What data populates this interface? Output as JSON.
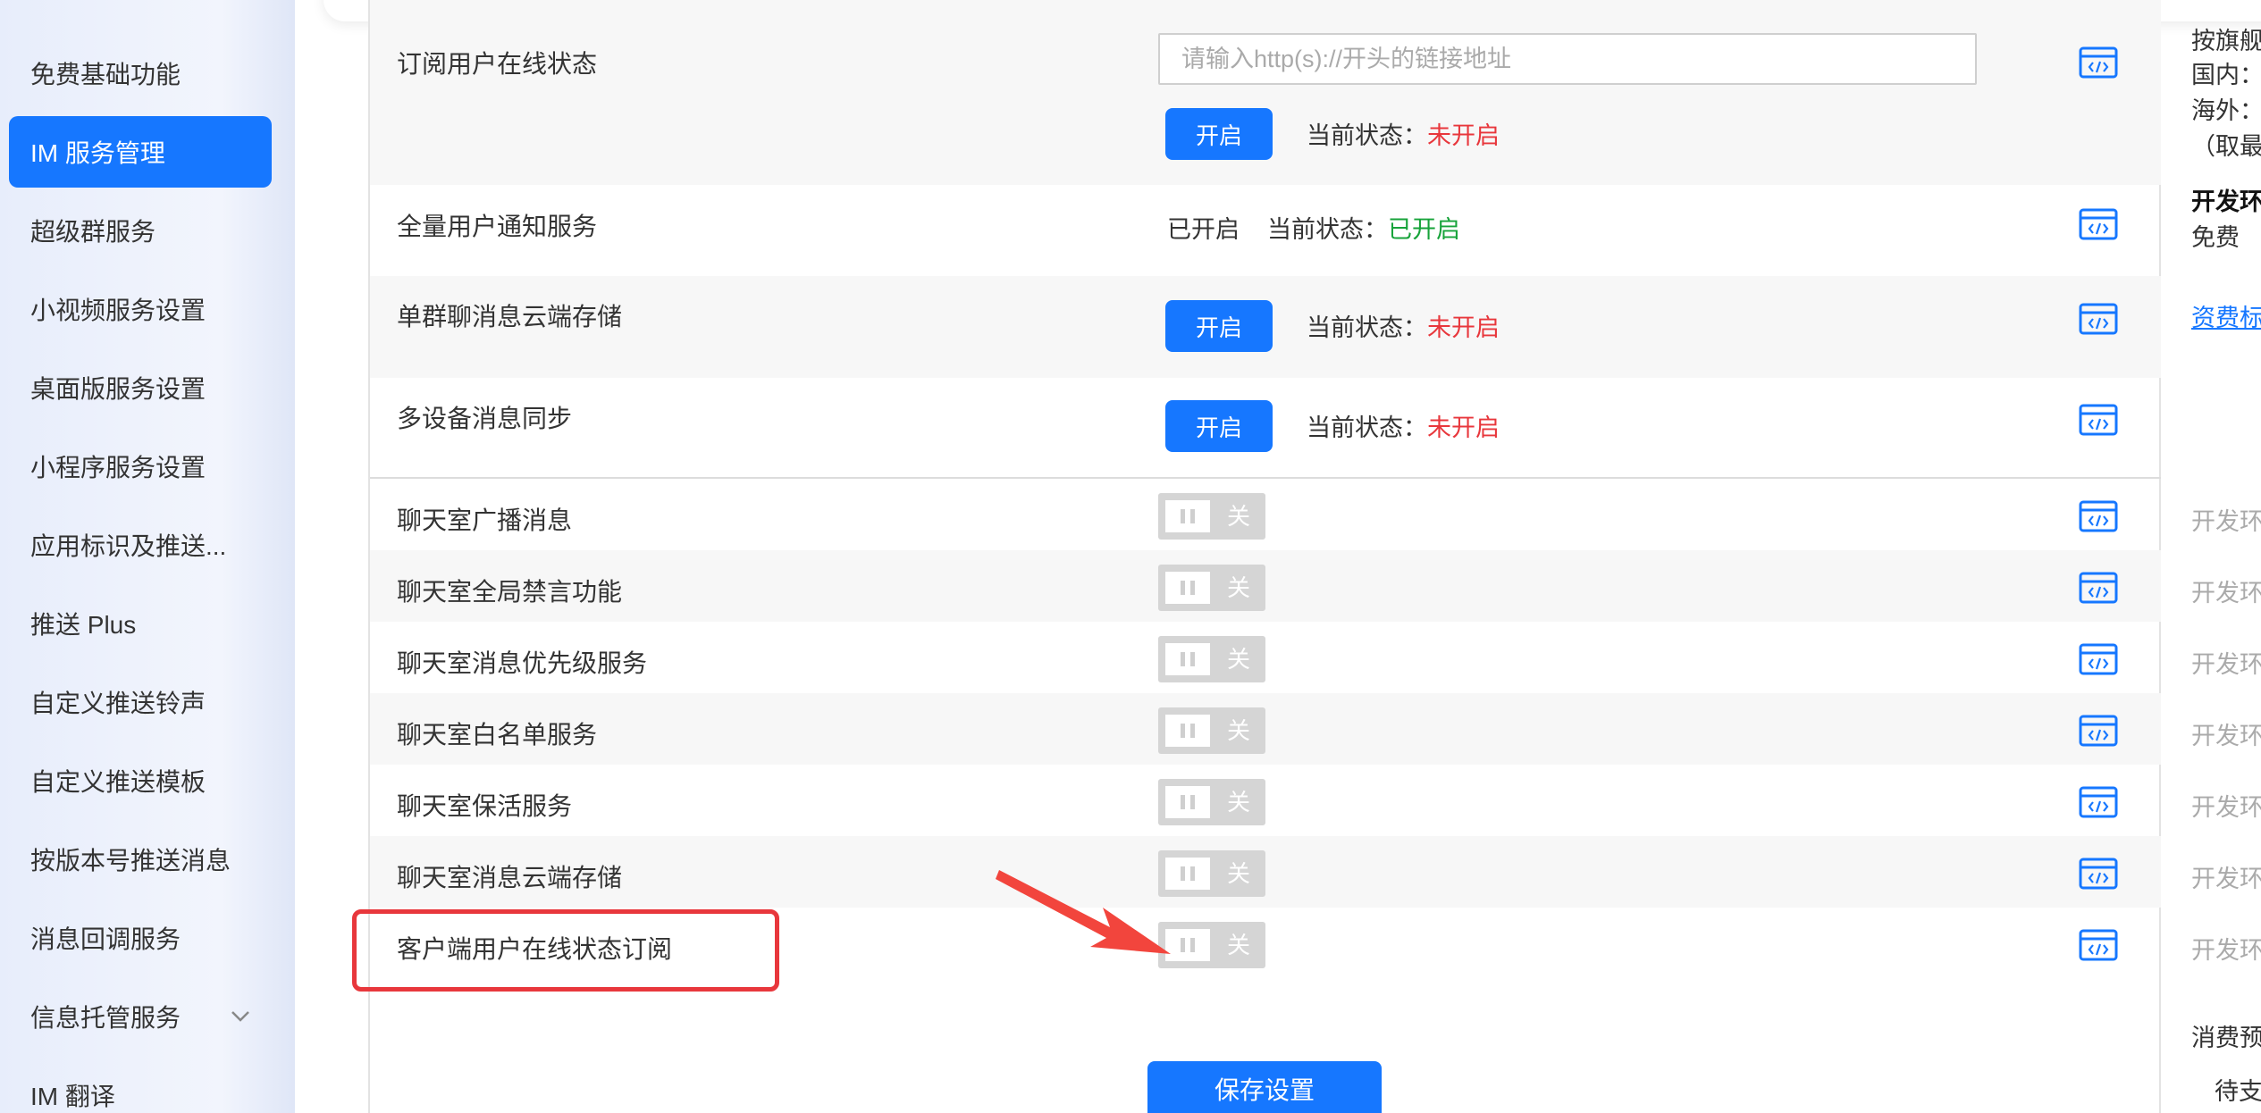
{
  "sidebar": {
    "items": [
      {
        "label": "免费基础功能"
      },
      {
        "label": "IM 服务管理",
        "active": true
      },
      {
        "label": "超级群服务"
      },
      {
        "label": "小视频服务设置"
      },
      {
        "label": "桌面版服务设置"
      },
      {
        "label": "小程序服务设置"
      },
      {
        "label": "应用标识及推送..."
      },
      {
        "label": "推送 Plus"
      },
      {
        "label": "自定义推送铃声"
      },
      {
        "label": "自定义推送模板"
      },
      {
        "label": "按版本号推送消息"
      },
      {
        "label": "消息回调服务"
      },
      {
        "label": "信息托管服务",
        "expandable": true,
        "icon": "chevron-down-icon"
      },
      {
        "label": "IM 翻译"
      }
    ]
  },
  "services": {
    "subscription": {
      "label": "订阅用户在线状态",
      "input_placeholder": "请输入http(s)://开头的链接地址",
      "button": "开启",
      "status_prefix": "当前状态：",
      "status": "未开启"
    },
    "broadcast": {
      "label": "全量用户通知服务",
      "enabled_text": "已开启",
      "status_prefix": "当前状态：",
      "status": "已开启"
    },
    "cloud_storage": {
      "label": "单群聊消息云端存储",
      "button": "开启",
      "status_prefix": "当前状态：",
      "status": "未开启"
    },
    "multi_device": {
      "label": "多设备消息同步",
      "button": "开启",
      "status_prefix": "当前状态：",
      "status": "未开启"
    }
  },
  "toggle_rows": [
    {
      "label": "聊天室广播消息",
      "toggle": "关",
      "env": "开发环"
    },
    {
      "label": "聊天室全局禁言功能",
      "toggle": "关",
      "env": "开发环"
    },
    {
      "label": "聊天室消息优先级服务",
      "toggle": "关",
      "env": "开发环"
    },
    {
      "label": "聊天室白名单服务",
      "toggle": "关",
      "env": "开发环"
    },
    {
      "label": "聊天室保活服务",
      "toggle": "关",
      "env": "开发环"
    },
    {
      "label": "聊天室消息云端存储",
      "toggle": "关",
      "env": "开发环"
    },
    {
      "label": "客户端用户在线状态订阅",
      "toggle": "关",
      "env": "开发环",
      "highlighted": true
    }
  ],
  "right_panel": {
    "line1": "按旗舰",
    "line2": "国内：",
    "line3": "海外：",
    "line4": "（取最",
    "dev_env": "开发环",
    "free": "免费",
    "pricing_link": "资费标",
    "consumption": "消费预",
    "pending": "待支"
  },
  "save_button": "保存设置",
  "colors": {
    "primary": "#1677ff",
    "status_off": "#e8373c",
    "status_on": "#17a33a",
    "annotation": "#e8373c"
  }
}
